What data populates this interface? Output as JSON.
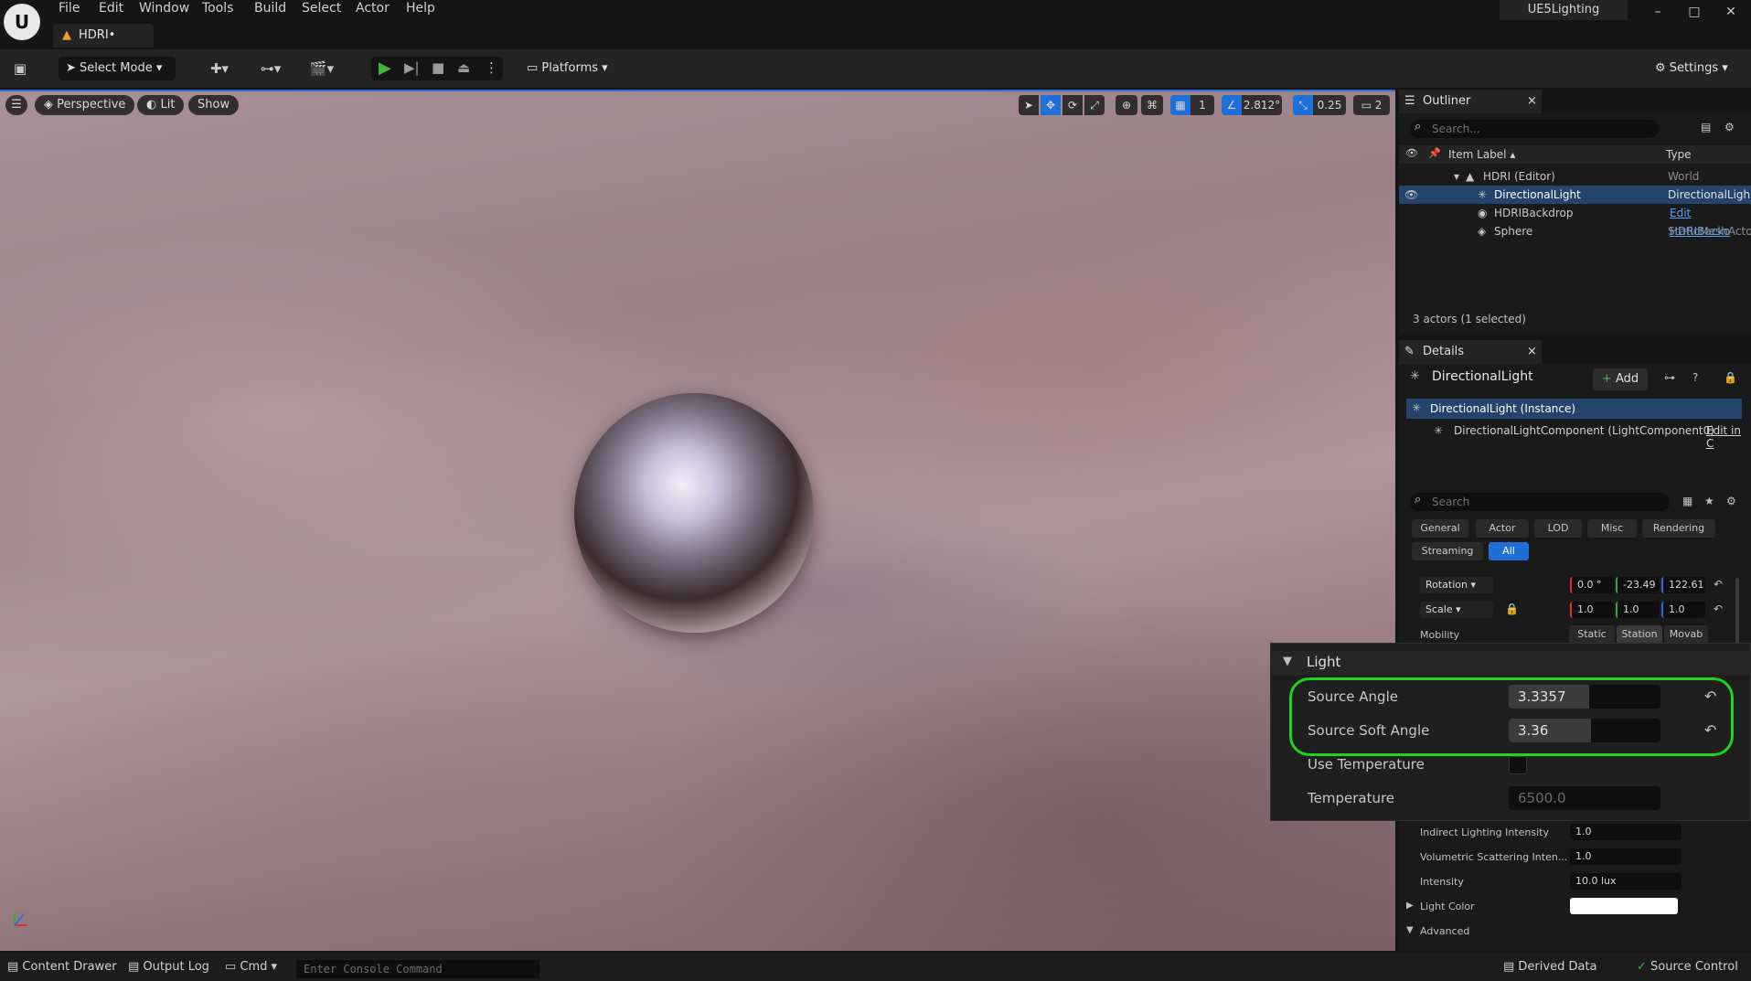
{
  "menu": [
    "File",
    "Edit",
    "Window",
    "Tools",
    "Build",
    "Select",
    "Actor",
    "Help"
  ],
  "document_tab": "HDRI•",
  "project_name": "UE5Lighting",
  "window_controls": [
    "–",
    "□",
    "✕"
  ],
  "toolbar": {
    "select_mode": "Select Mode",
    "platforms": "Platforms",
    "settings": "Settings"
  },
  "viewport": {
    "perspective": "Perspective",
    "lit": "Lit",
    "show": "Show",
    "grid_snap": "1",
    "rotation_snap": "2.812°",
    "scale_snap": "0.25",
    "camera_speed": "2"
  },
  "outliner": {
    "title": "Outliner",
    "search_placeholder": "Search...",
    "col_label": "Item Label",
    "col_type": "Type",
    "rows": [
      {
        "label": "HDRI (Editor)",
        "type": "World"
      },
      {
        "label": "DirectionalLight",
        "type": "DirectionalLigh"
      },
      {
        "label": "HDRIBackdrop",
        "type": "Edit HDRIBacko"
      },
      {
        "label": "Sphere",
        "type": "StaticMeshActo"
      }
    ],
    "count": "3 actors (1 selected)"
  },
  "details": {
    "title": "Details",
    "actor_name": "DirectionalLight",
    "add": "Add",
    "instance": "DirectionalLight (Instance)",
    "component": "DirectionalLightComponent (LightComponent0)",
    "component_edit": "Edit in C",
    "search_placeholder": "Search",
    "filters": [
      "General",
      "Actor",
      "LOD",
      "Misc",
      "Rendering",
      "Streaming",
      "All"
    ],
    "rotation_label": "Rotation",
    "rotation": [
      "0.0 °",
      "-23.49",
      "122.61"
    ],
    "scale_label": "Scale",
    "scale": [
      "1.0",
      "1.0",
      "1.0"
    ],
    "mobility_label": "Mobility",
    "mobility": [
      "Static",
      "Station",
      "Movab"
    ],
    "indirect_label": "Indirect Lighting Intensity",
    "indirect_value": "1.0",
    "volumetric_label": "Volumetric Scattering Inten...",
    "volumetric_value": "1.0",
    "intensity_label": "Intensity",
    "intensity_value": "10.0 lux",
    "light_color_label": "Light Color",
    "advanced_label": "Advanced"
  },
  "zoom": {
    "section": "Light",
    "source_angle_label": "Source Angle",
    "source_angle_value": "3.3357",
    "source_angle_fill": 0.53,
    "source_soft_angle_label": "Source Soft Angle",
    "source_soft_angle_value": "3.36",
    "source_soft_angle_fill": 0.54,
    "use_temperature_label": "Use Temperature",
    "temperature_label": "Temperature",
    "temperature_value": "6500.0"
  },
  "statusbar": {
    "content_drawer": "Content Drawer",
    "output_log": "Output Log",
    "cmd": "Cmd",
    "console_placeholder": "Enter Console Command",
    "derived_data": "Derived Data",
    "source_control": "Source Control"
  },
  "colors": {
    "selection": "#24446e",
    "accent": "#1f6fd8",
    "highlight": "#1fd31f",
    "play": "#3cb83c"
  }
}
